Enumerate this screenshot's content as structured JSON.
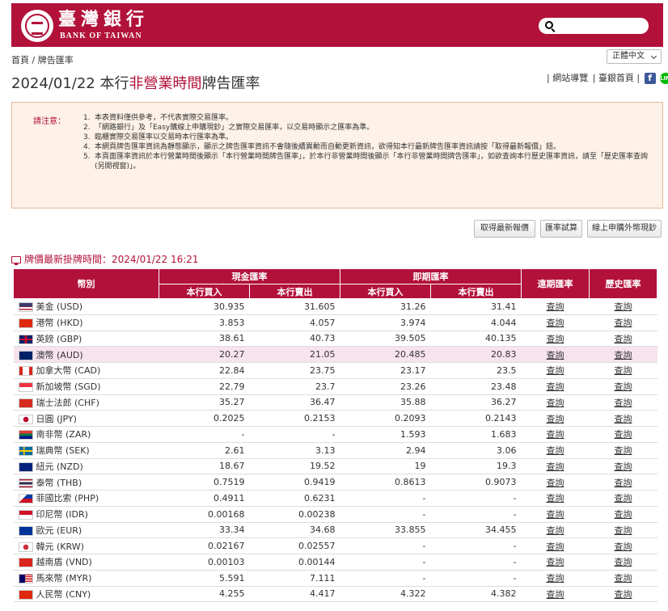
{
  "header": {
    "bank_name_cn": "臺灣銀行",
    "bank_name_en": "BANK OF TAIWAN",
    "search_placeholder": ""
  },
  "breadcrumb": "首頁 / 牌告匯率",
  "language": "正體中文",
  "title": {
    "prefix": "2024/01/22 本行",
    "highlight": "非營業時間",
    "suffix": "牌告匯率"
  },
  "toplinks": {
    "sitemap": "| 網站導覽",
    "home": "| 臺銀首頁 |"
  },
  "notice": {
    "label": "請注意：",
    "items": [
      "本表資料僅供參考，不代表實際交易匯率。",
      "「網路銀行」及「Easy購線上申購現鈔」之實際交易匯率，以交易時顯示之匯率為準。",
      "臨櫃實際交易匯率以交易時本行匯率為準。",
      "本網頁牌告匯率資訊為靜態顯示，顯示之牌告匯率資訊不會隨後續異動而自動更新資訊，欲得知本行最新牌告匯率資訊請按「取得最新報價」鈕。",
      "本頁面匯率資訊於本行營業時間後顯示「本行營業時間牌告匯率」，於本行非營業時間後顯示「本行非營業時間牌告匯率」，如欲查詢本行歷史匯率資訊，請至「歷史匯率查詢(另開視窗)」。"
    ]
  },
  "buttons": {
    "refresh": "取得最新報價",
    "calculator": "匯率試算",
    "online": "線上申購外幣現鈔"
  },
  "update_time": "牌價最新掛牌時間：2024/01/22 16:21",
  "table": {
    "headers": {
      "currency": "幣別",
      "cash": "現金匯率",
      "spot": "即期匯率",
      "forward": "遠期匯率",
      "history": "歷史匯率",
      "buy": "本行買入",
      "sell": "本行賣出"
    },
    "rows": [
      {
        "name": "美金 (USD)",
        "cash_buy": "30.935",
        "cash_sell": "31.605",
        "spot_buy": "31.26",
        "spot_sell": "31.41",
        "forward": "查詢",
        "history": "查詢"
      },
      {
        "name": "港幣 (HKD)",
        "cash_buy": "3.853",
        "cash_sell": "4.057",
        "spot_buy": "3.974",
        "spot_sell": "4.044",
        "forward": "查詢",
        "history": "查詢"
      },
      {
        "name": "英鎊 (GBP)",
        "cash_buy": "38.61",
        "cash_sell": "40.73",
        "spot_buy": "39.505",
        "spot_sell": "40.135",
        "forward": "查詢",
        "history": "查詢"
      },
      {
        "name": "澳幣 (AUD)",
        "cash_buy": "20.27",
        "cash_sell": "21.05",
        "spot_buy": "20.485",
        "spot_sell": "20.83",
        "forward": "查詢",
        "history": "查詢"
      },
      {
        "name": "加拿大幣 (CAD)",
        "cash_buy": "22.84",
        "cash_sell": "23.75",
        "spot_buy": "23.17",
        "spot_sell": "23.5",
        "forward": "查詢",
        "history": "查詢"
      },
      {
        "name": "新加坡幣 (SGD)",
        "cash_buy": "22.79",
        "cash_sell": "23.7",
        "spot_buy": "23.26",
        "spot_sell": "23.48",
        "forward": "查詢",
        "history": "查詢"
      },
      {
        "name": "瑞士法郎 (CHF)",
        "cash_buy": "35.27",
        "cash_sell": "36.47",
        "spot_buy": "35.88",
        "spot_sell": "36.27",
        "forward": "查詢",
        "history": "查詢"
      },
      {
        "name": "日圓 (JPY)",
        "cash_buy": "0.2025",
        "cash_sell": "0.2153",
        "spot_buy": "0.2093",
        "spot_sell": "0.2143",
        "forward": "查詢",
        "history": "查詢"
      },
      {
        "name": "南非幣 (ZAR)",
        "cash_buy": "-",
        "cash_sell": "-",
        "spot_buy": "1.593",
        "spot_sell": "1.683",
        "forward": "查詢",
        "history": "查詢"
      },
      {
        "name": "瑞典幣 (SEK)",
        "cash_buy": "2.61",
        "cash_sell": "3.13",
        "spot_buy": "2.94",
        "spot_sell": "3.06",
        "forward": "查詢",
        "history": "查詢"
      },
      {
        "name": "紐元 (NZD)",
        "cash_buy": "18.67",
        "cash_sell": "19.52",
        "spot_buy": "19",
        "spot_sell": "19.3",
        "forward": "查詢",
        "history": "查詢"
      },
      {
        "name": "泰幣 (THB)",
        "cash_buy": "0.7519",
        "cash_sell": "0.9419",
        "spot_buy": "0.8613",
        "spot_sell": "0.9073",
        "forward": "查詢",
        "history": "查詢"
      },
      {
        "name": "菲國比索 (PHP)",
        "cash_buy": "0.4911",
        "cash_sell": "0.6231",
        "spot_buy": "-",
        "spot_sell": "-",
        "forward": "查詢",
        "history": "查詢"
      },
      {
        "name": "印尼幣 (IDR)",
        "cash_buy": "0.00168",
        "cash_sell": "0.00238",
        "spot_buy": "-",
        "spot_sell": "-",
        "forward": "查詢",
        "history": "查詢"
      },
      {
        "name": "歐元 (EUR)",
        "cash_buy": "33.34",
        "cash_sell": "34.68",
        "spot_buy": "33.855",
        "spot_sell": "34.455",
        "forward": "查詢",
        "history": "查詢"
      },
      {
        "name": "韓元 (KRW)",
        "cash_buy": "0.02167",
        "cash_sell": "0.02557",
        "spot_buy": "-",
        "spot_sell": "-",
        "forward": "查詢",
        "history": "查詢"
      },
      {
        "name": "越南盾 (VND)",
        "cash_buy": "0.00103",
        "cash_sell": "0.00144",
        "spot_buy": "-",
        "spot_sell": "-",
        "forward": "查詢",
        "history": "查詢"
      },
      {
        "name": "馬來幣 (MYR)",
        "cash_buy": "5.591",
        "cash_sell": "7.111",
        "spot_buy": "-",
        "spot_sell": "-",
        "forward": "查詢",
        "history": "查詢"
      },
      {
        "name": "人民幣 (CNY)",
        "cash_buy": "4.255",
        "cash_sell": "4.417",
        "spot_buy": "4.322",
        "spot_sell": "4.382",
        "forward": "查詢",
        "history": "查詢"
      }
    ]
  },
  "colors": {
    "brand": "#b2113a",
    "highlight_row": "#f7e3ee",
    "notice_bg": "#fdf1e8"
  }
}
